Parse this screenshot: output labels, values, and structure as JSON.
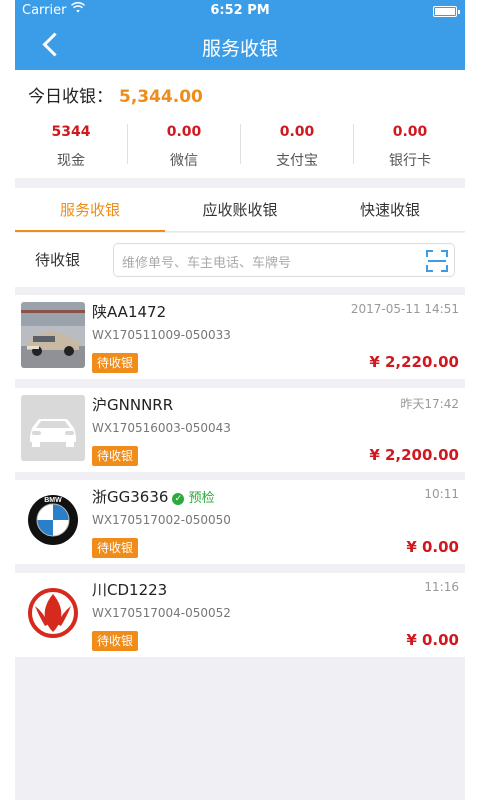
{
  "status_bar": {
    "carrier": "Carrier",
    "time": "6:52 PM"
  },
  "header": {
    "title": "服务收银"
  },
  "summary": {
    "today_label": "今日收银：",
    "today_amount": "5,344.00",
    "payments": [
      {
        "value": "5344",
        "label": "现金"
      },
      {
        "value": "0.00",
        "label": "微信"
      },
      {
        "value": "0.00",
        "label": "支付宝"
      },
      {
        "value": "0.00",
        "label": "银行卡"
      }
    ]
  },
  "tabs": [
    {
      "label": "服务收银",
      "active": true
    },
    {
      "label": "应收账收银",
      "active": false
    },
    {
      "label": "快速收银",
      "active": false
    }
  ],
  "filter": {
    "label": "待收银",
    "placeholder": "维修单号、车主电话、车牌号"
  },
  "orders": [
    {
      "plate": "陕AA1472",
      "tag": "",
      "date": "2017-05-11 14:51",
      "order_no": "WX170511009-050033",
      "status": "待收银",
      "amount": "¥ 2,220.00",
      "thumb": "car-photo"
    },
    {
      "plate": "沪GNNNRR",
      "tag": "",
      "date": "昨天17:42",
      "order_no": "WX170516003-050043",
      "status": "待收银",
      "amount": "¥ 2,200.00",
      "thumb": "car-placeholder"
    },
    {
      "plate": "浙GG3636",
      "tag": "预检",
      "date": "10:11",
      "order_no": "WX170517002-050050",
      "status": "待收银",
      "amount": "¥ 0.00",
      "thumb": "bmw-logo"
    },
    {
      "plate": "川CD1223",
      "tag": "",
      "date": "11:16",
      "order_no": "WX170517004-050052",
      "status": "待收银",
      "amount": "¥ 0.00",
      "thumb": "dongfeng-logo"
    }
  ],
  "colors": {
    "header": "#3b9de8",
    "accent": "#f08c1a",
    "amount": "#d0181f",
    "tag": "#2bab3b"
  }
}
